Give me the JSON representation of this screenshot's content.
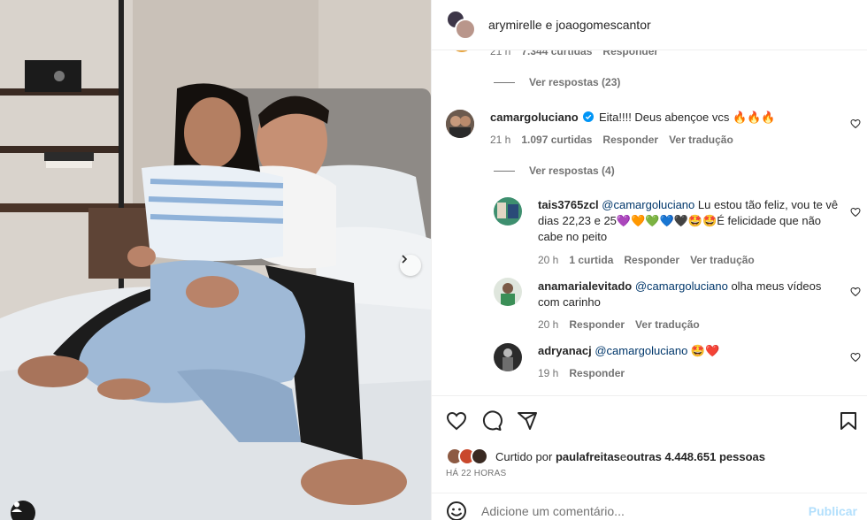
{
  "header": {
    "author_line": "arymirelle e joaogomescantor"
  },
  "comments": {
    "prev_meta": {
      "time": "21 h",
      "likes": "7.344 curtidas",
      "reply": "Responder"
    },
    "view_replies_1": "Ver respostas (23)",
    "main": {
      "user": "camargoluciano",
      "text": "Eita!!!! Deus abençoe vcs 🔥🔥🔥",
      "time": "21 h",
      "likes": "1.097 curtidas",
      "reply": "Responder",
      "translate": "Ver tradução"
    },
    "view_replies_2": "Ver respostas (4)",
    "replies": [
      {
        "user": "tais3765zcl",
        "mention": "@camargoluciano",
        "text": " Lu estou tão feliz, vou te vê dias 22,23 e 25💜🧡💚💙🖤🤩🤩É felicidade que não cabe no peito",
        "time": "20 h",
        "likes": "1 curtida",
        "reply": "Responder",
        "translate": "Ver tradução"
      },
      {
        "user": "anamarialevitado",
        "mention": "@camargoluciano",
        "text": " olha meus vídeos com carinho",
        "time": "20 h",
        "reply": "Responder",
        "translate": "Ver tradução"
      },
      {
        "user": "adryanacj",
        "mention": "@camargoluciano",
        "text": " 🤩❤️",
        "time": "19 h",
        "reply": "Responder"
      }
    ]
  },
  "actions": {
    "liked_prefix": "Curtido por ",
    "liked_user": "paulafreitas",
    "liked_mid": " e ",
    "liked_count": "outras 4.448.651 pessoas",
    "posted_ago": "HÁ 22 HORAS"
  },
  "comment_box": {
    "placeholder": "Adicione um comentário...",
    "publish": "Publicar"
  },
  "colors": {
    "text": "#262626",
    "secondary": "#737373",
    "mention": "#00376b",
    "verified": "#0095f6",
    "publish_disabled": "#b2dffc",
    "divider": "#efefef"
  },
  "icons": [
    "heart-icon",
    "comment-icon",
    "share-icon",
    "bookmark-icon",
    "emoji-icon",
    "chevron-right-icon",
    "verified-badge-icon",
    "user-tag-icon"
  ]
}
